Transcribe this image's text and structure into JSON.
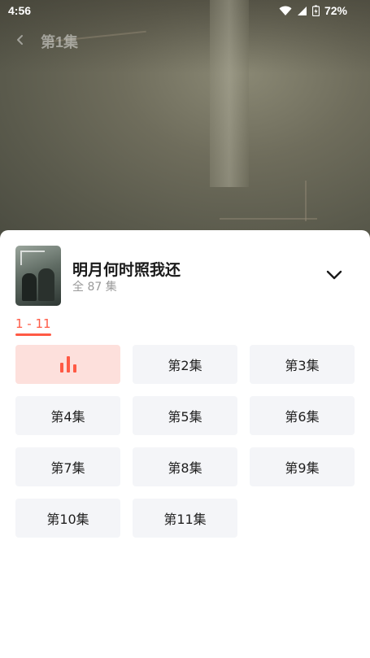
{
  "status_bar": {
    "time": "4:56",
    "battery": "72%"
  },
  "player": {
    "episode_title": "第1集"
  },
  "sheet": {
    "show_title": "明月何时照我还",
    "episode_count": "全 87 集",
    "range_tabs": [
      {
        "label": "1 - 11",
        "selected": true
      }
    ],
    "episodes": [
      {
        "label": "",
        "playing": true
      },
      {
        "label": "第2集"
      },
      {
        "label": "第3集"
      },
      {
        "label": "第4集"
      },
      {
        "label": "第5集"
      },
      {
        "label": "第6集"
      },
      {
        "label": "第7集"
      },
      {
        "label": "第8集"
      },
      {
        "label": "第9集"
      },
      {
        "label": "第10集"
      },
      {
        "label": "第11集"
      }
    ]
  },
  "colors": {
    "accent": "#ff5a45",
    "active_bg": "#fde0dc",
    "tile_bg": "#f4f5f8"
  }
}
